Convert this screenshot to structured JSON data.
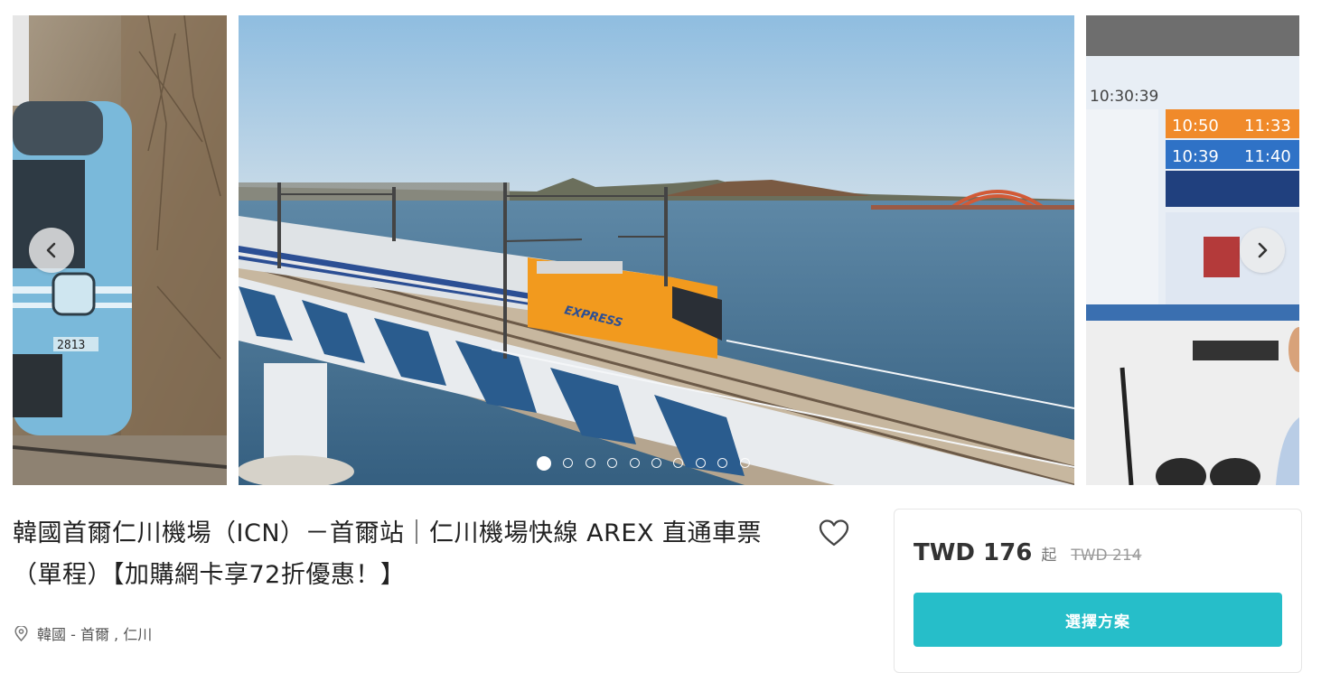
{
  "product": {
    "title": "韓國首爾仁川機場（ICN）－首爾站｜仁川機場快線 AREX 直通車票（單程）【加購網卡享72折優惠！】",
    "location": "韓國 - 首爾 , 仁川"
  },
  "gallery": {
    "slide_count": 10,
    "active_index": 0,
    "left_slide": {
      "car_number": "2813"
    },
    "main_slide": {
      "train_label": "EXPRESS"
    },
    "right_slide": {
      "clock": "10:30:39",
      "row1": [
        "10:50",
        "11:33"
      ],
      "row2": [
        "10:39",
        "11:40"
      ]
    }
  },
  "pricing": {
    "price": "TWD 176",
    "from_label": "起",
    "original_price": "TWD 214",
    "select_label": "選擇方案"
  },
  "colors": {
    "accent": "#26bec9",
    "train_orange": "#f29a1e",
    "sky": "#9fc4e3",
    "water": "#3f6e91"
  },
  "icons": {
    "prev": "chevron-left-icon",
    "next": "chevron-right-icon",
    "favorite": "heart-icon",
    "location": "map-pin-icon"
  }
}
